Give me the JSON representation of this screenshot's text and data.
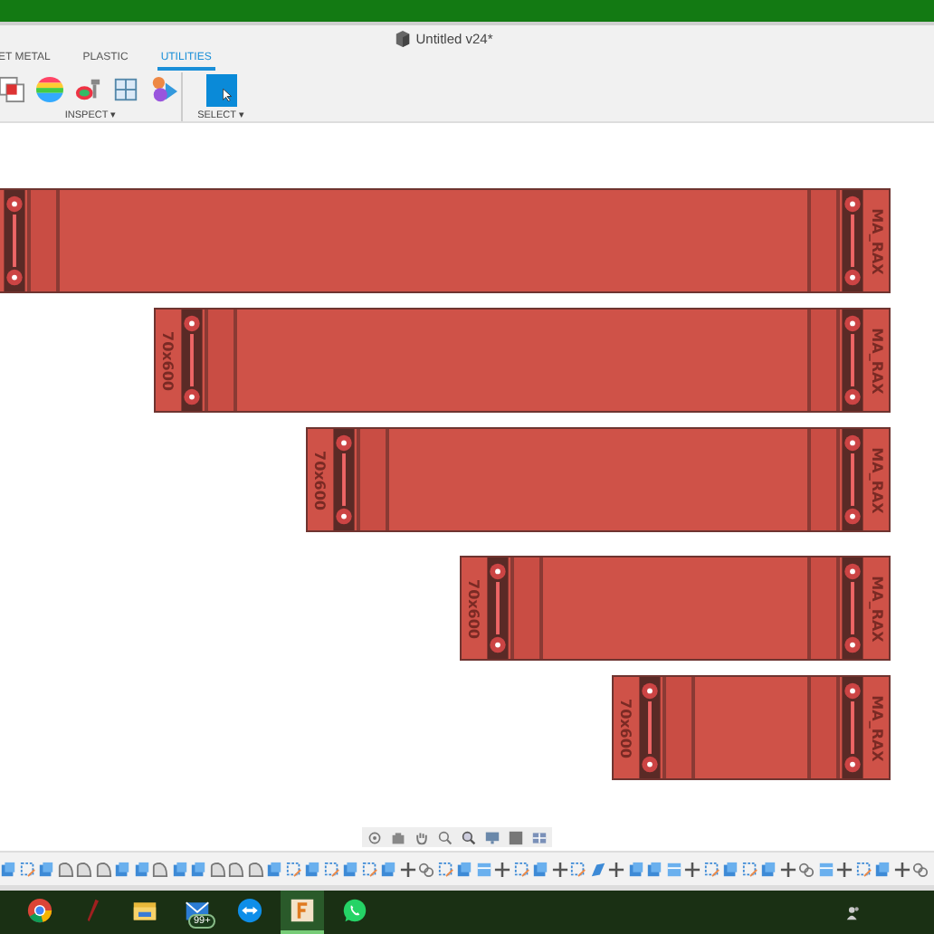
{
  "window": {
    "title": "Untitled v24*"
  },
  "tabs": [
    {
      "label": "ET METAL",
      "selected": false
    },
    {
      "label": "PLASTIC",
      "selected": false
    },
    {
      "label": "UTILITIES",
      "selected": true
    }
  ],
  "tool_groups": [
    {
      "label": "INSPECT",
      "caret": "▾"
    },
    {
      "label": "SELECT",
      "caret": "▾"
    }
  ],
  "parts": [
    {
      "right_label": "MA_RAX"
    },
    {
      "left_label": "70x600",
      "right_label": "MA_RAX"
    },
    {
      "left_label": "70x600",
      "right_label": "MA_RAX"
    },
    {
      "left_label": "70x600",
      "right_label": "MA_RAX"
    },
    {
      "left_label": "70x600",
      "right_label": "MA_RAX"
    }
  ],
  "taskbar": {
    "apps": [
      {
        "kind": "browser",
        "selected": false
      },
      {
        "kind": "pen",
        "selected": false
      },
      {
        "kind": "folder",
        "selected": false
      },
      {
        "kind": "mail",
        "selected": false,
        "badge": "99+"
      },
      {
        "kind": "remote",
        "selected": false
      },
      {
        "kind": "fusion",
        "selected": true
      },
      {
        "kind": "chat",
        "selected": false
      }
    ]
  }
}
